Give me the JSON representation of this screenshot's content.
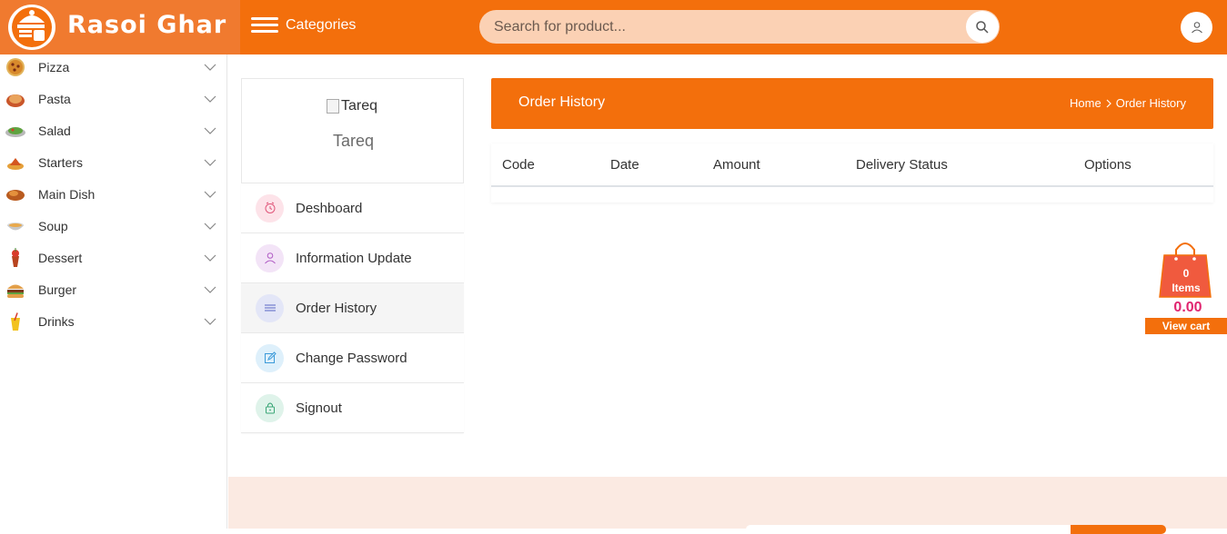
{
  "brand": {
    "name": "Rasoi Ghar",
    "accent": "#f36f0c"
  },
  "header": {
    "categories_label": "Categories",
    "search_placeholder": "Search for product...",
    "search_icon": "search-icon",
    "user_icon": "user-icon"
  },
  "sidebar": {
    "items": [
      {
        "label": "Pizza",
        "icon": "pizza-icon"
      },
      {
        "label": "Pasta",
        "icon": "pasta-icon"
      },
      {
        "label": "Salad",
        "icon": "salad-icon"
      },
      {
        "label": "Starters",
        "icon": "starters-icon"
      },
      {
        "label": "Main Dish",
        "icon": "main-dish-icon"
      },
      {
        "label": "Soup",
        "icon": "soup-icon"
      },
      {
        "label": "Dessert",
        "icon": "dessert-icon"
      },
      {
        "label": "Burger",
        "icon": "burger-icon"
      },
      {
        "label": "Drinks",
        "icon": "drinks-icon"
      }
    ]
  },
  "profile": {
    "image_alt": "Tareq",
    "name": "Tareq"
  },
  "account_menu": [
    {
      "label": "Deshboard",
      "icon": "clock-icon"
    },
    {
      "label": "Information Update",
      "icon": "user-icon"
    },
    {
      "label": "Order History",
      "icon": "list-icon",
      "active": true
    },
    {
      "label": "Change Password",
      "icon": "edit-icon"
    },
    {
      "label": "Signout",
      "icon": "lock-icon"
    }
  ],
  "page": {
    "title": "Order History",
    "breadcrumb": [
      "Home",
      "Order History"
    ]
  },
  "table": {
    "columns": [
      "Code",
      "Date",
      "Amount",
      "Delivery Status",
      "Options"
    ],
    "rows": []
  },
  "cart": {
    "count": "0",
    "items_label": "Items",
    "amount": "0.00",
    "view_label": "View cart"
  }
}
